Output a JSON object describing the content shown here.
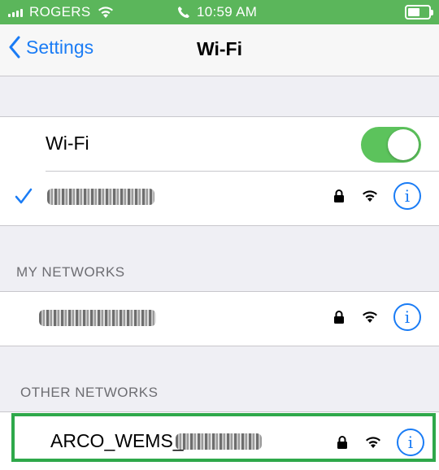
{
  "status_bar": {
    "carrier": "ROGERS",
    "time": "10:59 AM",
    "status_color": "#5bb65b"
  },
  "nav": {
    "back_label": "Settings",
    "title": "Wi-Fi"
  },
  "wifi": {
    "label": "Wi-Fi",
    "enabled": true,
    "toggle_color": "#5cc35c"
  },
  "sections": {
    "my_networks": "MY NETWORKS",
    "other_networks": "OTHER NETWORKS"
  },
  "other_network": {
    "name_visible": "ARCO_WEMS_"
  },
  "accent": "#1a7cf5",
  "highlight_color": "#2ea84a",
  "icons": {
    "info": "i"
  }
}
